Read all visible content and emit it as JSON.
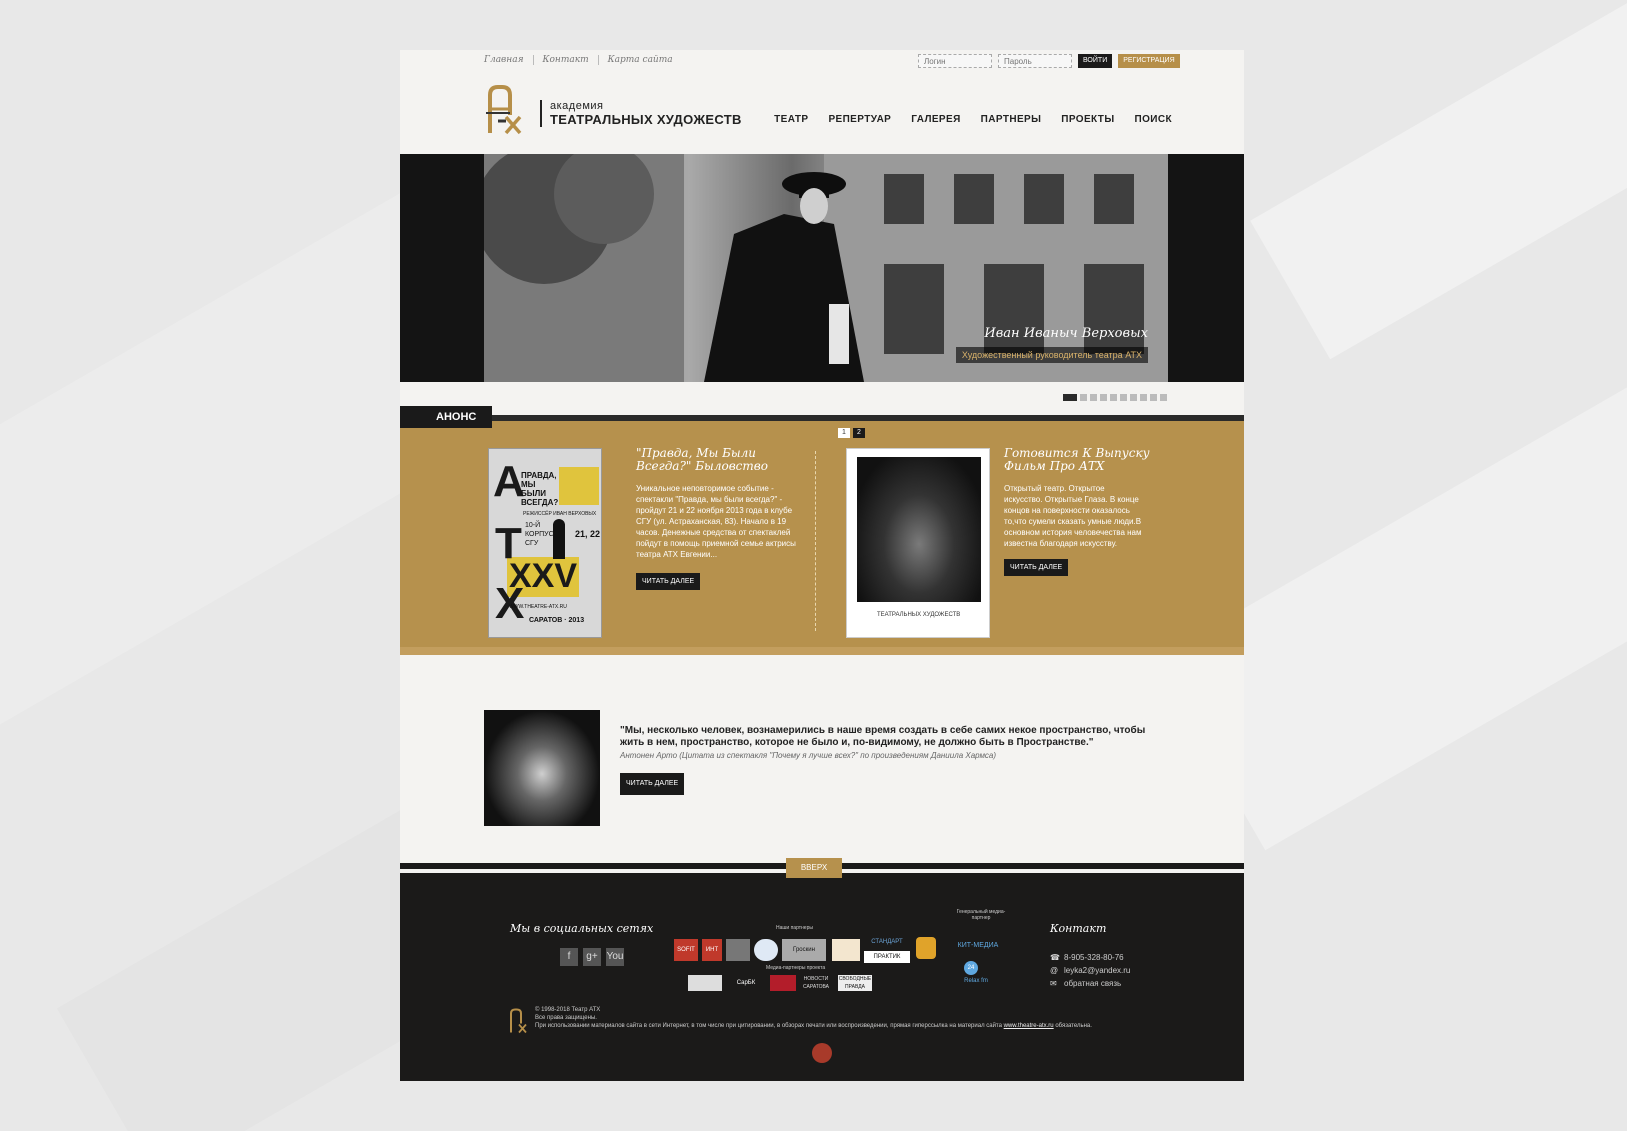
{
  "topnav": {
    "home": "Главная",
    "contact": "Контакт",
    "sitemap": "Карта сайта"
  },
  "login": {
    "login_placeholder": "Логин",
    "password_placeholder": "Пароль",
    "enter": "ВОЙТИ",
    "register": "РЕГИСТРАЦИЯ"
  },
  "logo": {
    "line1": "академия",
    "line2": "ТЕАТРАЛЬНЫХ ХУДОЖЕСТВ"
  },
  "mainnav": [
    "ТЕАТР",
    "РЕПЕРТУАР",
    "ГАЛЕРЕЯ",
    "ПАРТНЕРЫ",
    "ПРОЕКТЫ",
    "ПОИСК"
  ],
  "hero": {
    "name": "Иван Иваныч Верховых",
    "role": "Художественный руководитель театра АТХ",
    "slides": 10,
    "active_slide": 1
  },
  "anons": {
    "tab": "АНОНС",
    "pager": [
      "1",
      "2"
    ],
    "card1": {
      "title": "\"Правда, Мы Были Всегда?\" Быловство",
      "text": "Уникальное неповторимое событие - спектакли \"Правда, мы были всегда?\" - пройдут 21 и 22 ноября 2013 года в клубе СГУ (ул. Астраханская, 83). Начало в 19 часов. Денежные средства от спектаклей пойдут в помощь приемной семье актрисы театра АТХ Евгении...",
      "button": "ЧИТАТЬ ДАЛЕЕ",
      "poster": {
        "a": "А",
        "t": "Т",
        "x": "Х",
        "xxv": "XXV",
        "academy": "Академия",
        "title": "ПРАВДА, МЫ БЫЛИ ВСЕГДА?",
        "director": "РЕЖИССЁР ИВАН ВЕРХОВЫХ",
        "venue": "10-Й КОРПУС СГУ",
        "dates": "21, 22",
        "site": "WWW.THEATRE-ATX.RU",
        "city": "САРАТОВ · 2013"
      }
    },
    "card2": {
      "title": "Готовится К Выпуску Фильм Про АТХ",
      "text": "Открытый театр. Открытое искусство. Открытые Глаза. В конце концов на поверхности оказалось то,что сумели сказать умные люди.В основном история человечества нам известна благодаря искусству.",
      "button": "ЧИТАТЬ ДАЛЕЕ",
      "mini_logo": "ТЕАТРАЛЬНЫХ ХУДОЖЕСТВ"
    }
  },
  "quote": {
    "text": "\"Мы, несколько человек, вознамерились в наше время создать в себе самих некое пространство, чтобы жить в нем, пространство, которое не было и, по-видимому, не должно быть в Пространстве.\"",
    "author": "Антонен Арто (Цитата из спектакля \"Почему я лучше всех?\" по произведениям Даниила Хармса)",
    "button": "ЧИТАТЬ ДАЛЕЕ"
  },
  "up": "ВВЕРХ",
  "footer": {
    "social_title": "Мы в социальных сетях",
    "social": [
      "f",
      "g+",
      "You"
    ],
    "partners_label": "Наши партнеры",
    "media_label": "Медиа-партнеры проекта",
    "general_label": "Генеральный медиа-партнер",
    "partners": [
      "SOFIT",
      "ИНТ",
      "",
      "",
      "Гроскин",
      "",
      "СТАНДАРТ",
      "ПРАКТИК",
      ""
    ],
    "media": [
      "",
      "СарБК",
      "",
      "НОВОСТИ САРАТОВА",
      "СВОБОДНЫЕ ПРАВДА"
    ],
    "general": [
      "КИТ-МЕДИА",
      "24",
      "Relax fm"
    ],
    "contact_title": "Контакт",
    "phone": "8-905-328-80-76",
    "email": "leyka2@yandex.ru",
    "feedback": "обратная связь",
    "copyright": "© 1998-2018 Театр АТХ",
    "rights": "Все права защищены.",
    "notice_pre": "При использовании материалов сайта в сети Интернет, в том числе при цитировании, в обзорах печати или воспроизведении, прямая гиперссылка на материал сайта ",
    "notice_link": "www.theatre-atx.ru",
    "notice_post": " обязательна."
  }
}
